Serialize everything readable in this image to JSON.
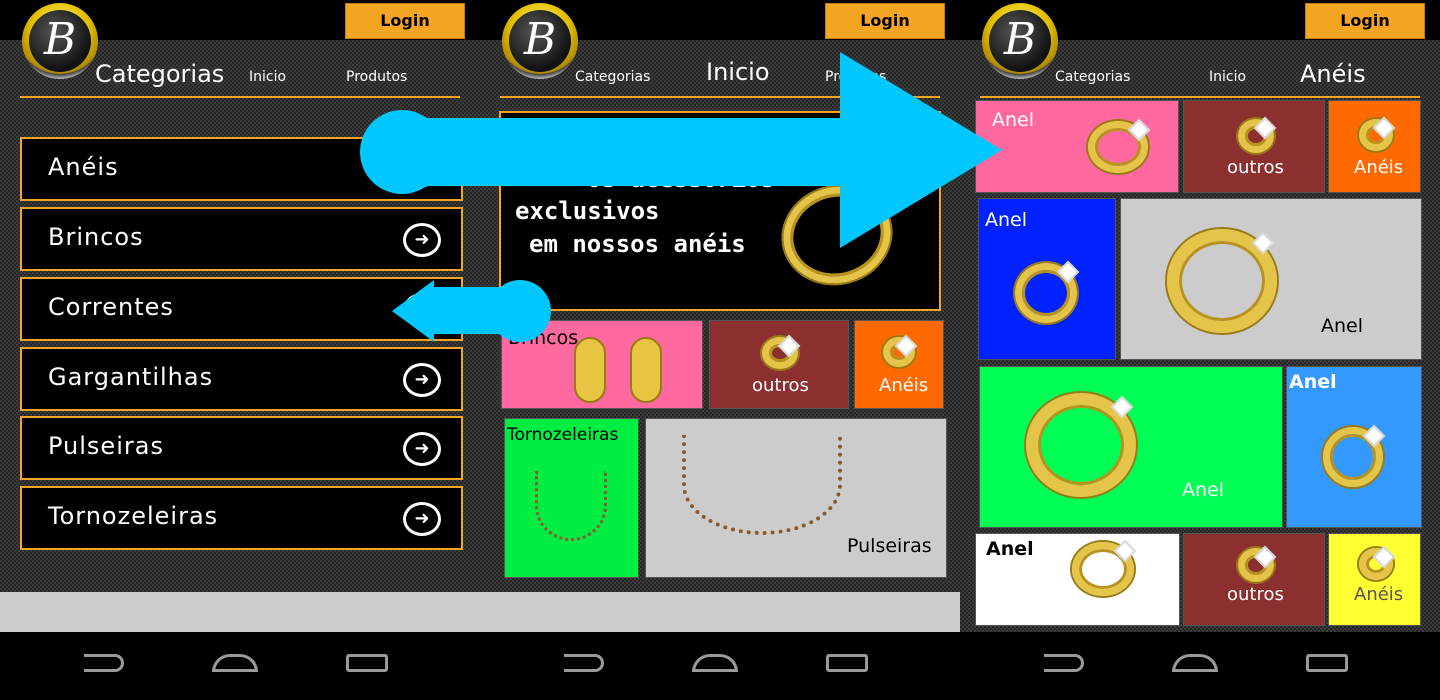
{
  "screens": [
    {
      "login": "Login",
      "logo_letter": "B",
      "nav": {
        "cat": "Categorias",
        "home": "Inicio",
        "prod": "Produtos"
      }
    },
    {
      "login": "Login",
      "logo_letter": "B",
      "nav": {
        "cat": "Categorias",
        "home": "Inicio",
        "prod": "Produtos"
      }
    },
    {
      "login": "Login",
      "logo_letter": "B",
      "nav": {
        "cat": "Categorias",
        "home": "Inicio",
        "aneis": "Anéis"
      }
    }
  ],
  "categories": [
    "Anéis",
    "Brincos",
    "Correntes",
    "Gargantilhas",
    "Pulseiras",
    "Tornozeleiras"
  ],
  "banner": {
    "line1": "Os acessórios",
    "line2": "exclusivos",
    "line3": "em nossos anéis"
  },
  "home_tiles": {
    "brincos": "Brincos",
    "outros": "outros",
    "aneis": "Anéis",
    "tornozeleiras": "Tornozeleiras",
    "pulseiras": "Pulseiras"
  },
  "ring_tiles": {
    "anel": "Anel",
    "outros": "outros",
    "aneis": "Anéis"
  },
  "colors": {
    "accent": "#f4a523",
    "arrow": "#00c8ff",
    "pink": "#ff69a0",
    "maroon": "#8b2f2f",
    "orange": "#ff6a00",
    "blue": "#0022ff",
    "green": "#00ff55",
    "lightblue": "#3399ff",
    "yellow": "#ffff33",
    "grey": "#cccccc"
  },
  "icons": {
    "back": "back-icon",
    "home": "home-icon",
    "recent": "recent-apps-icon",
    "arrow": "arrow-right-circle-icon"
  }
}
